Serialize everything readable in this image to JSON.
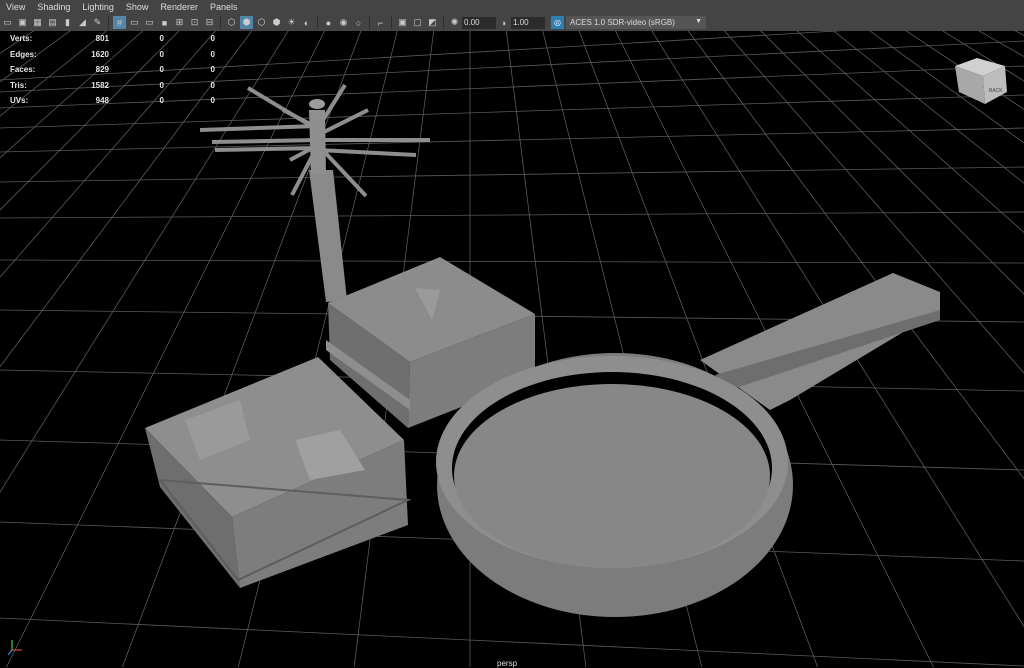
{
  "menu": [
    "View",
    "Shading",
    "Lighting",
    "Show",
    "Renderer",
    "Panels"
  ],
  "toolbar": {
    "exposure": "0.00",
    "gamma": "1.00",
    "colorspace": "ACES 1.0 SDR-video (sRGB)"
  },
  "hud": {
    "rows": [
      {
        "label": "Verts:",
        "values": [
          "801",
          "0",
          "0"
        ]
      },
      {
        "label": "Edges:",
        "values": [
          "1620",
          "0",
          "0"
        ]
      },
      {
        "label": "Faces:",
        "values": [
          "829",
          "0",
          "0"
        ]
      },
      {
        "label": "Tris:",
        "values": [
          "1582",
          "0",
          "0"
        ]
      },
      {
        "label": "UVs:",
        "values": [
          "948",
          "0",
          "0"
        ]
      }
    ]
  },
  "viewcube": {
    "label": "BACK"
  },
  "camera": "persp",
  "colors": {
    "panel": "#444444",
    "viewport": "#000000",
    "grid": "#5a5a5a",
    "mesh": "#8a8a8a",
    "accent": "#5285a6"
  }
}
